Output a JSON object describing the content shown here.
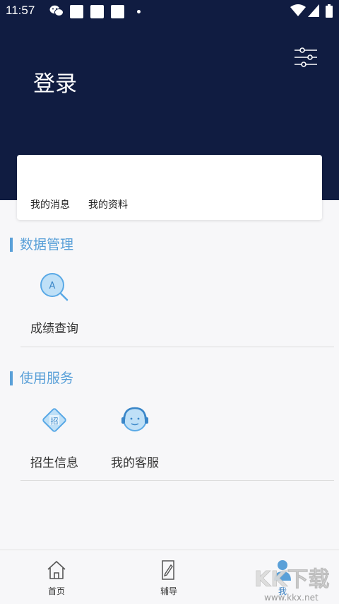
{
  "status": {
    "time": "11:57"
  },
  "header": {
    "title": "登录"
  },
  "card": {
    "messages_label": "我的消息",
    "profile_label": "我的资料"
  },
  "sections": [
    {
      "title": "数据管理",
      "items": [
        {
          "label": "成绩查询",
          "icon": "score-query-icon"
        }
      ]
    },
    {
      "title": "使用服务",
      "items": [
        {
          "label": "招生信息",
          "icon": "admission-info-icon"
        },
        {
          "label": "我的客服",
          "icon": "customer-service-icon"
        }
      ]
    }
  ],
  "tabs": [
    {
      "label": "首页",
      "icon": "home-icon"
    },
    {
      "label": "辅导",
      "icon": "tutoring-icon"
    },
    {
      "label": "我",
      "icon": "me-icon",
      "active": true
    }
  ],
  "watermark": {
    "text": "KK下载",
    "url": "www.kkx.net"
  },
  "colors": {
    "header_bg": "#101c41",
    "accent": "#5aa0d8",
    "page_bg": "#f7f7f9"
  }
}
